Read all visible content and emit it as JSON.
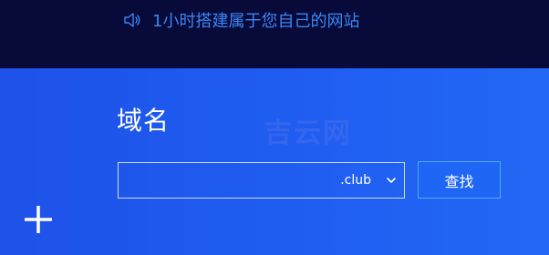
{
  "announcement": {
    "icon": "speaker-icon",
    "text": "1小时搭建属于您自己的网站",
    "color": "#3b86f3"
  },
  "domain_search": {
    "title": "域名",
    "watermark": "吉云网",
    "input_value": "",
    "suffix": ".club",
    "search_label": "查找"
  },
  "side": {
    "plus_icon": "plus-icon"
  },
  "colors": {
    "banner_bg": "#080a3a",
    "main_bg": "#1f5ff0",
    "button_border": "#4fa8ff"
  }
}
